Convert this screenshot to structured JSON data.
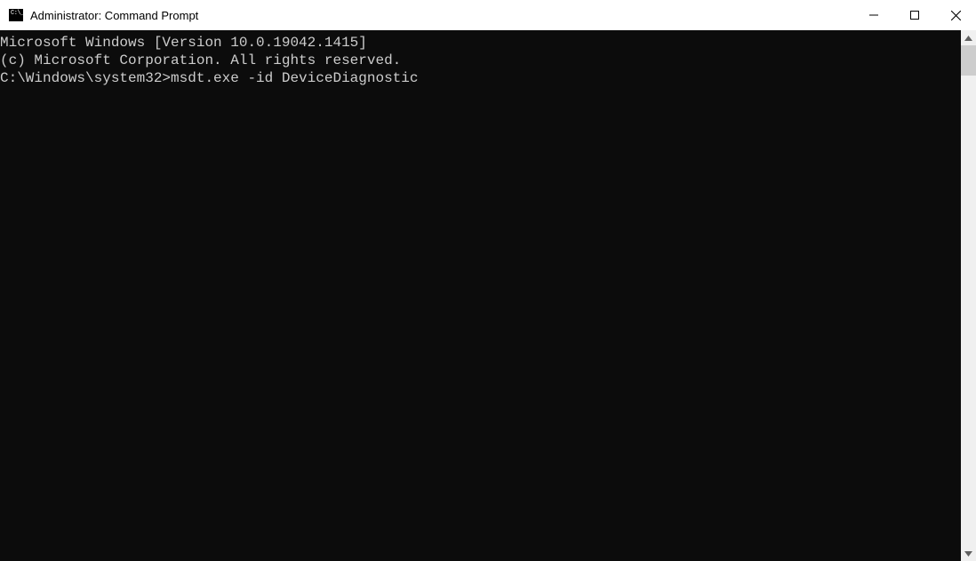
{
  "window": {
    "title": "Administrator: Command Prompt"
  },
  "terminal": {
    "line1": "Microsoft Windows [Version 10.0.19042.1415]",
    "line2": "(c) Microsoft Corporation. All rights reserved.",
    "blank": "",
    "prompt": "C:\\Windows\\system32>",
    "command": "msdt.exe -id DeviceDiagnostic"
  }
}
